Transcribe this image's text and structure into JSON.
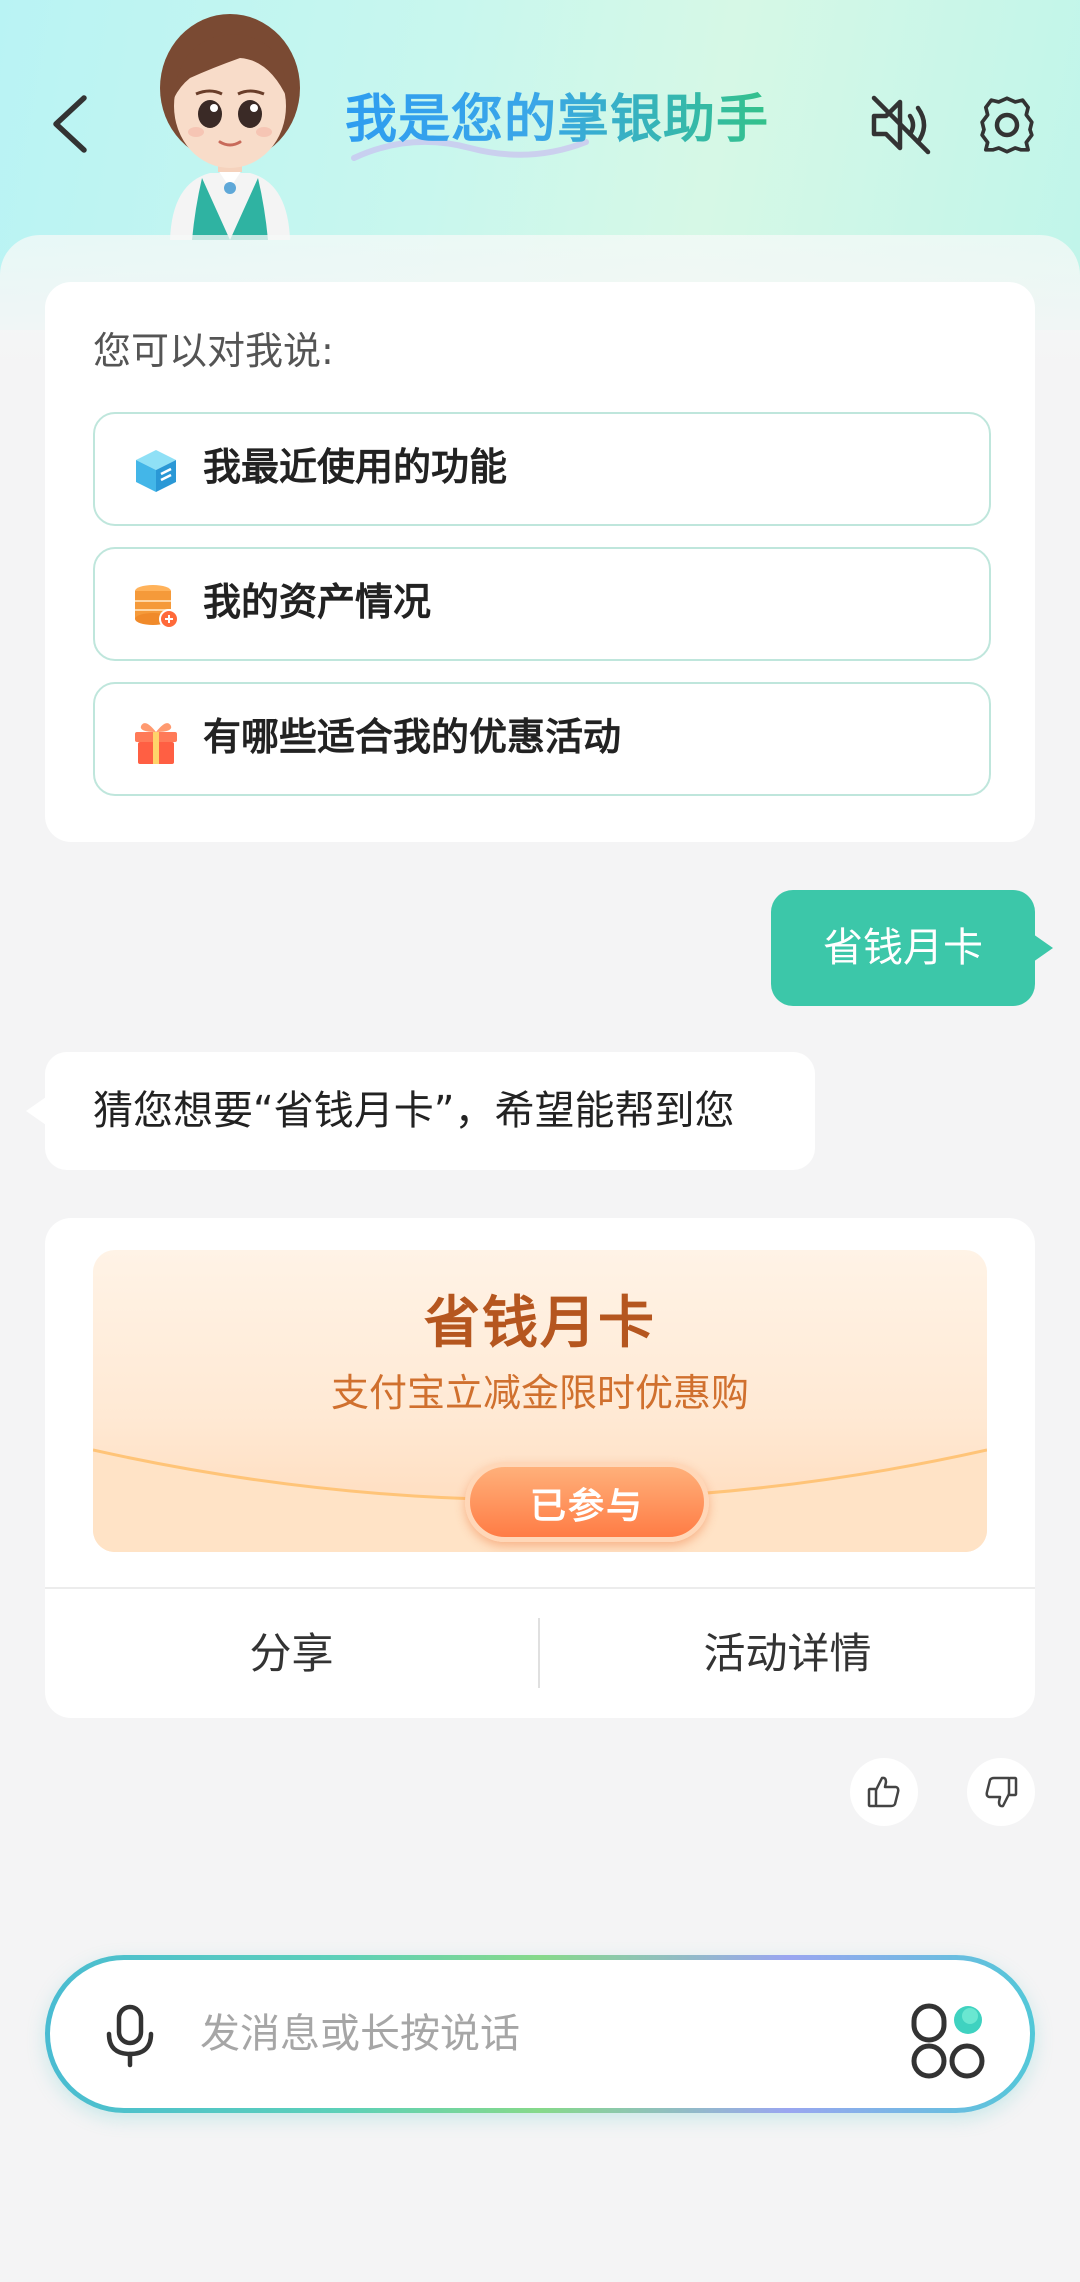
{
  "header": {
    "title": "我是您的掌银助手"
  },
  "suggestions": {
    "hint": "您可以对我说:",
    "items": [
      {
        "label": "我最近使用的功能",
        "icon": "cube-icon"
      },
      {
        "label": "我的资产情况",
        "icon": "coin-stack-icon"
      },
      {
        "label": "有哪些适合我的优惠活动",
        "icon": "gift-icon"
      }
    ]
  },
  "chat": {
    "user_message": "省钱月卡",
    "bot_message": "猜您想要“省钱月卡”，希望能帮到您"
  },
  "promo": {
    "title": "省钱月卡",
    "subtitle": "支付宝立减金限时优惠购",
    "status_button": "已参与",
    "share_label": "分享",
    "details_label": "活动详情"
  },
  "input": {
    "placeholder": "发消息或长按说话"
  },
  "colors": {
    "accent": "#3cc7a9",
    "promo_title": "#b5561f",
    "promo_button": "#ff7c45"
  }
}
